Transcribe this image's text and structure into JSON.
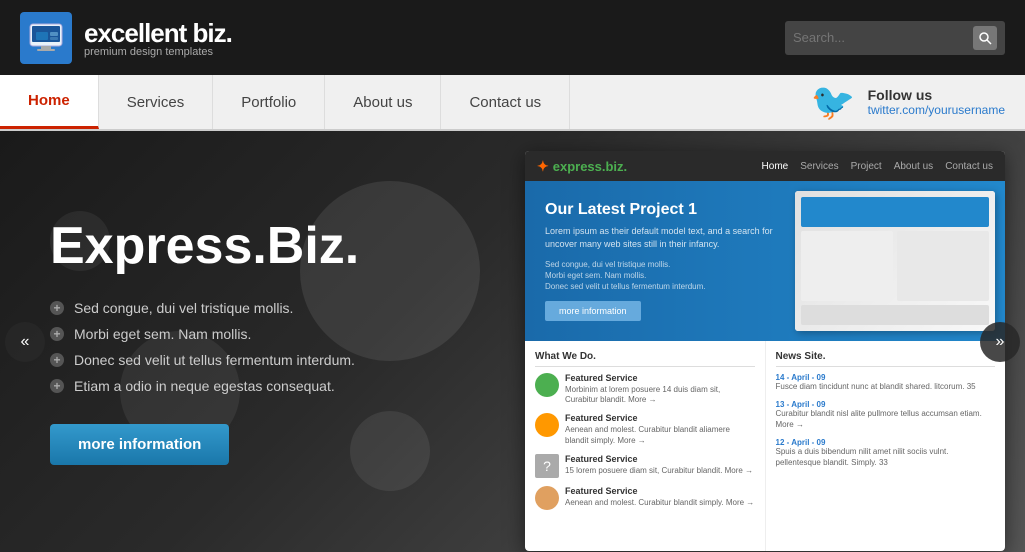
{
  "header": {
    "brand": "excellent biz.",
    "tagline": "premium design templates",
    "search_placeholder": "Search..."
  },
  "nav": {
    "items": [
      {
        "label": "Home",
        "active": true
      },
      {
        "label": "Services",
        "active": false
      },
      {
        "label": "Portfolio",
        "active": false
      },
      {
        "label": "About us",
        "active": false
      },
      {
        "label": "Contact us",
        "active": false
      }
    ],
    "follow_label": "Follow us",
    "twitter_link": "twitter.com/yourusername"
  },
  "hero": {
    "title": "Express.Biz.",
    "bullets": [
      "Sed congue, dui vel tristique mollis.",
      "Morbi eget sem. Nam mollis.",
      "Donec sed velit ut tellus fermentum interdum.",
      "Etiam a odio in neque egestas consequat."
    ],
    "cta_label": "more information"
  },
  "screenshot": {
    "logo": "express.biz.",
    "nav": [
      "Home",
      "Services",
      "Project",
      "About us",
      "Contact us"
    ],
    "hero_title": "Our Latest Project 1",
    "hero_desc": "Lorem ipsum as their default model text, and a search for uncover many web sites still in their infancy.",
    "hero_bullets": [
      "Sed congue, dui vel tristique mollis.",
      "Morbi eget sem. Nam mollis.",
      "Donec sed velit ut tellus fermentum interdum."
    ],
    "hero_btn": "more information",
    "sections": {
      "what_we_do": "What We Do.",
      "news": "News Site.",
      "services": [
        {
          "title": "Featured Service",
          "desc": "Morbinim at lorem posuere 14 duis diam sit, Curabitur blandit. More →"
        },
        {
          "title": "Featured Service",
          "desc": "Aenean and molest. Curabitur blandit aliamere blandit simply. More →"
        },
        {
          "title": "Featured Service",
          "desc": "15 lorem posuere diam sit, Curabitur blandit. More →"
        },
        {
          "title": "Featured Service",
          "desc": "Aenean and molest. Curabitur blandit simply. More →"
        }
      ],
      "news_items": [
        {
          "date": "14 - April - 09",
          "text": "Fusce diam tincidunt nunc at blandit shared. litcorum. 35"
        },
        {
          "date": "13 - April - 09",
          "text": "Curabitur blandit nisl alite pullmore tellus accumsan etiam. More →"
        },
        {
          "date": "12 - April - 09",
          "text": "Spuis a duis bibendum nilit amet nilit sociis vulnt. pellentesque blandit. Simply. 33"
        }
      ]
    }
  },
  "arrows": {
    "left": "«",
    "right": "»"
  }
}
